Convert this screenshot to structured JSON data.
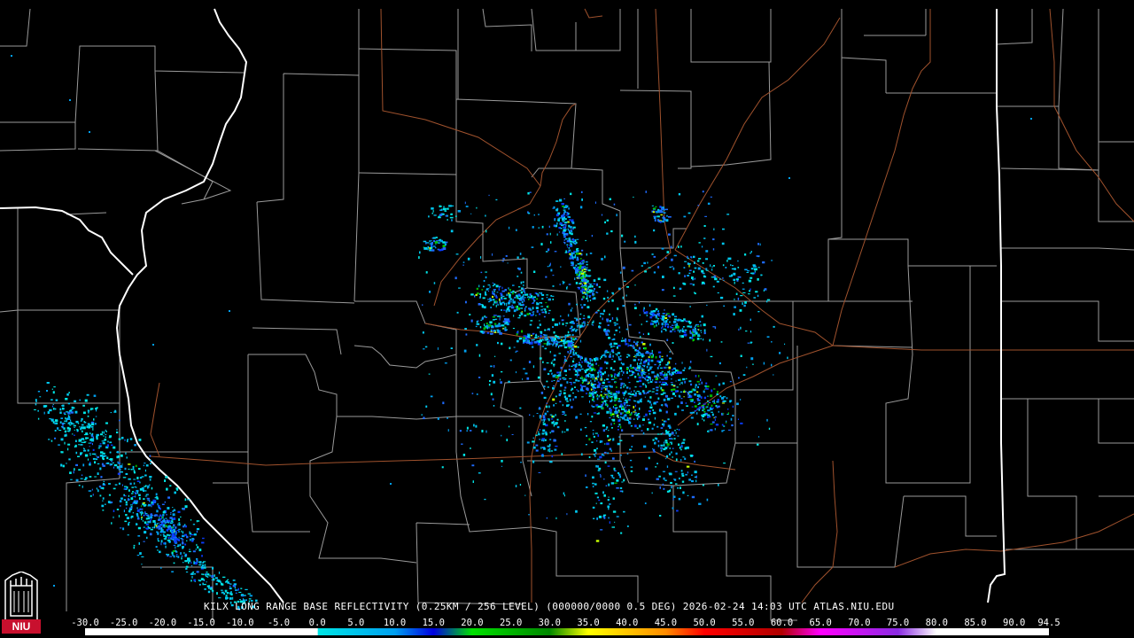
{
  "product": {
    "caption": "KILX LONG RANGE BASE REFLECTIVITY (0.25KM / 256 LEVEL) (000000/0000 0.5 DEG) 2026-02-24 14:03 UTC  ATLAS.NIU.EDU"
  },
  "logo": {
    "text": "NIU",
    "color": "#c8102e"
  },
  "colors": {
    "county_lines": "#9a9a9a",
    "state_lines": "#ffffff",
    "highways": "#a0522d",
    "background": "#000000"
  },
  "legend": {
    "labels": [
      "-30.0",
      "-25.0",
      "-20.0",
      "-15.0",
      "-10.0",
      "-5.0",
      "0.0",
      "5.0",
      "10.0",
      "15.0",
      "20.0",
      "25.0",
      "30.0",
      "35.0",
      "40.0",
      "45.0",
      "50.0",
      "55.0",
      "60.0",
      "65.0",
      "70.0",
      "75.0",
      "80.0",
      "85.0",
      "90.0",
      "94.5"
    ],
    "min": -30.0,
    "max": 94.5,
    "gradient": [
      {
        "v": -30,
        "c": "#ffffff"
      },
      {
        "v": 0,
        "c": "#ffffff"
      },
      {
        "v": 0.1,
        "c": "#00e5e5"
      },
      {
        "v": 10,
        "c": "#00a0f0"
      },
      {
        "v": 15,
        "c": "#0000e0"
      },
      {
        "v": 20,
        "c": "#00e000"
      },
      {
        "v": 30,
        "c": "#008800"
      },
      {
        "v": 35,
        "c": "#ffff00"
      },
      {
        "v": 45,
        "c": "#ff8c00"
      },
      {
        "v": 50,
        "c": "#ff0000"
      },
      {
        "v": 60,
        "c": "#b00000"
      },
      {
        "v": 65,
        "c": "#ff00ff"
      },
      {
        "v": 75,
        "c": "#8a2be2"
      },
      {
        "v": 80,
        "c": "#ffffff"
      },
      {
        "v": 94.5,
        "c": "#ffffff"
      }
    ]
  },
  "radar_site": {
    "id": "KILX"
  }
}
